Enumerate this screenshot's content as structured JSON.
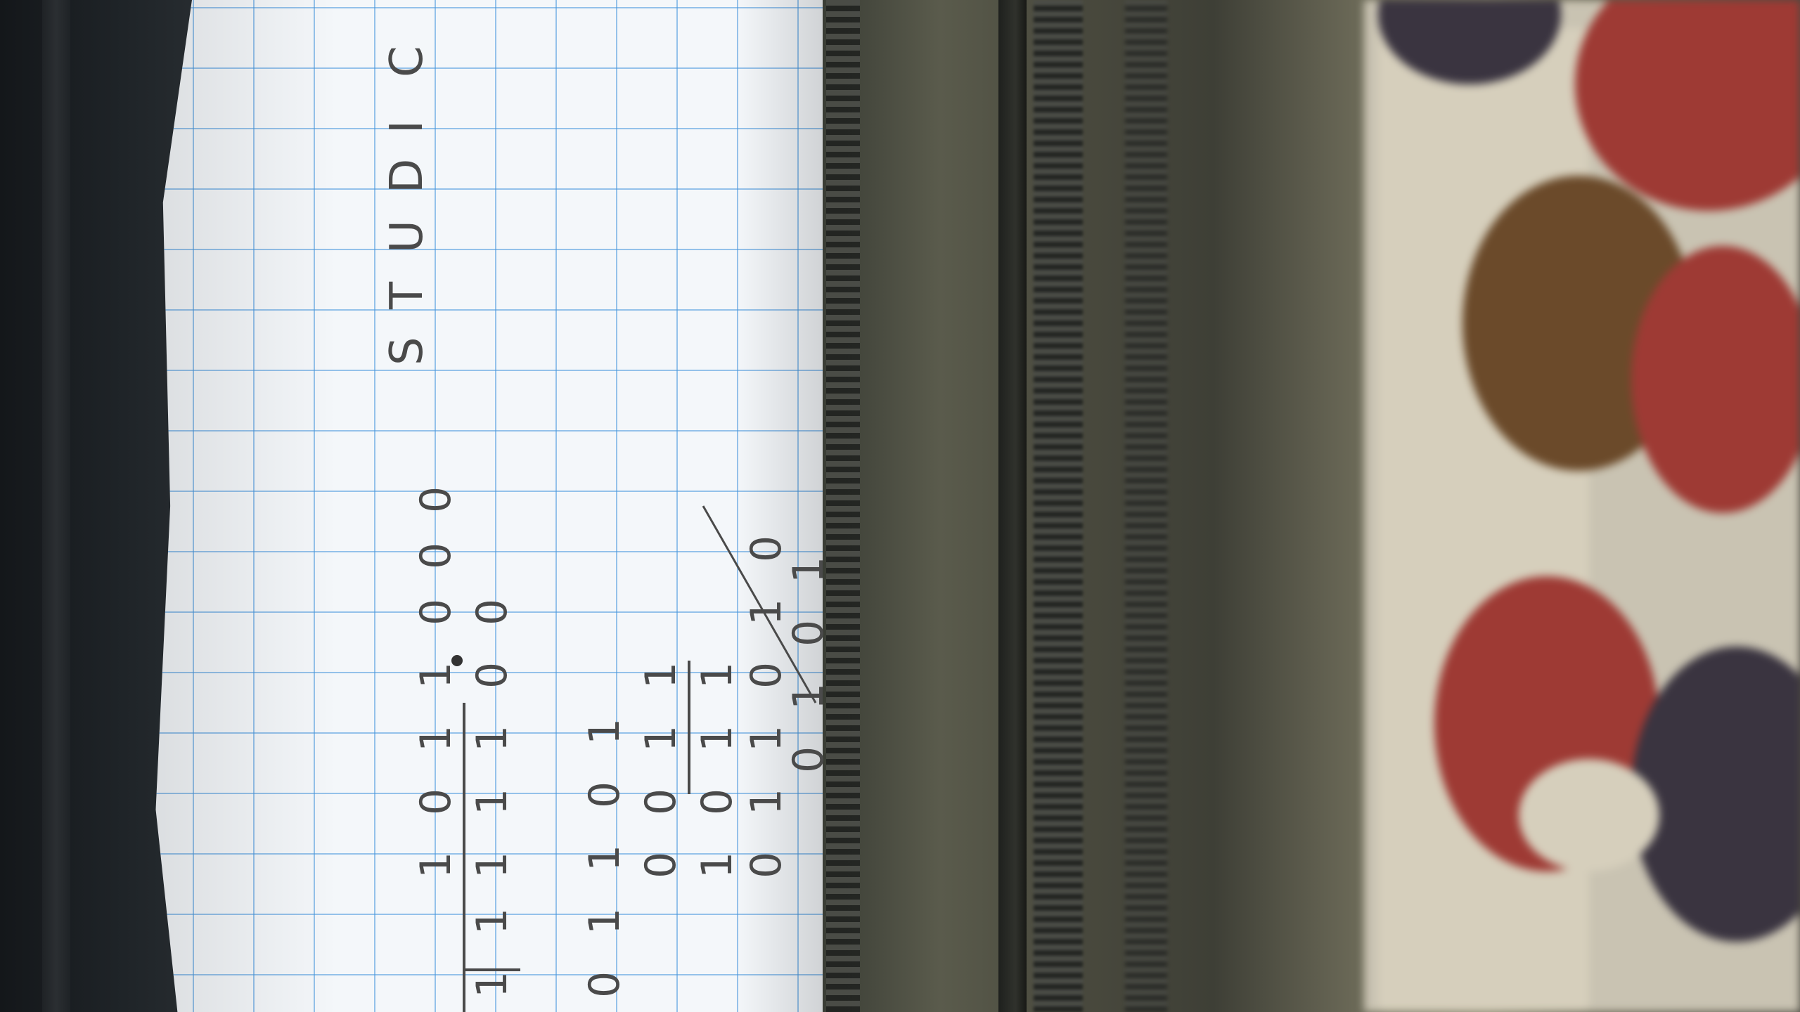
{
  "photo": {
    "subject": "Rotated photograph of graph paper with handwritten binary long division, lying on a bag with a zipper and a patterned fabric"
  },
  "handwriting": {
    "word_letters": [
      "S",
      "T",
      "U",
      "D",
      "I",
      "C"
    ],
    "dividend_digits": [
      "1",
      "0",
      "1",
      "1",
      "0",
      "0",
      "0"
    ],
    "divisor_digits": [
      "1",
      "1"
    ],
    "quotient_row": [
      "1",
      "1",
      "1",
      "0",
      "0"
    ],
    "step_rows": [
      [
        "0",
        "1",
        "1",
        "0",
        "1"
      ],
      [
        "0",
        "0",
        "1",
        "1"
      ],
      [
        "1",
        "0",
        "1",
        "1"
      ],
      [
        "0",
        "1",
        "1",
        "0",
        "1",
        "0"
      ],
      [
        "0",
        "1",
        "0",
        "1"
      ]
    ]
  },
  "colors": {
    "paper": "#f4f7fa",
    "grid": "#4696dc",
    "ink": "#4a4a4a",
    "bag": "#5a5b4c",
    "fabric_red": "#9e3a34",
    "fabric_brown": "#6b4a2a",
    "fabric_cream": "#d6cfbc",
    "fabric_dark": "#3a3440"
  }
}
